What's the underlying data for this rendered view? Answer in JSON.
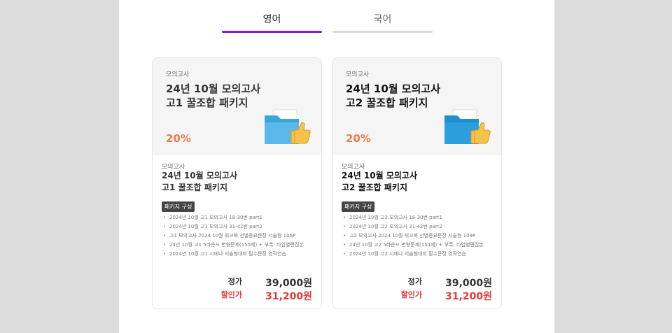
{
  "tabs": [
    {
      "label": "영어",
      "active": true
    },
    {
      "label": "국어",
      "active": false
    }
  ],
  "colors": {
    "accent": "#7a1fd1",
    "discount": "#f07a4a",
    "sale": "#e23c3c"
  },
  "products": [
    {
      "category": "모의고사",
      "title_line1": "24년 10월 모의고사",
      "title_line2": "고1 꿀조합 패키지",
      "discount": "20%",
      "body_category": "모의고사",
      "body_title_line1": "24년 10월 모의고사",
      "body_title_line2": "고1 꿀조합 패키지",
      "badge": "패키지 구성",
      "items": [
        "2024년 10월 고1 모의고사 18-30번 part1",
        "2024년 10월 고1 모의고사 31-42번 part2",
        "고1 모의고사 2024 10월 워크북 선별중요문장 서술형 106P",
        "24년 10월 고1 5라운드 변형문제(155제) + 부록: 타입별편집본",
        "2024년 10월 고1 시에나 서술형대비 필수문장 영작연습"
      ],
      "price_label": "정가",
      "price": "39,000원",
      "sale_label": "할인가",
      "sale_price": "31,200원"
    },
    {
      "category": "모의고사",
      "title_line1": "24년 10월 모의고사",
      "title_line2": "고2 꿀조합 패키지",
      "discount": "20%",
      "body_category": "모의고사",
      "body_title_line1": "24년 10월 모의고사",
      "body_title_line2": "고2 꿀조합 패키지",
      "badge": "패키지 구성",
      "items": [
        "2024년 10월 고2 모의고사 18-30번 part1",
        "2024년 10월 고2 모의고사 31-42번 part2",
        "고2 모의고사 2024 10월 워크북 선별중요문장 서술형 109P",
        "24년 10월 고2 5라운드 변형문제(154제) + 부록: 타입별편집본",
        "2024년 10월 고2 시에나 서술형대비 필수문장 영작연습"
      ],
      "price_label": "정가",
      "price": "39,000원",
      "sale_label": "할인가",
      "sale_price": "31,200원"
    }
  ]
}
